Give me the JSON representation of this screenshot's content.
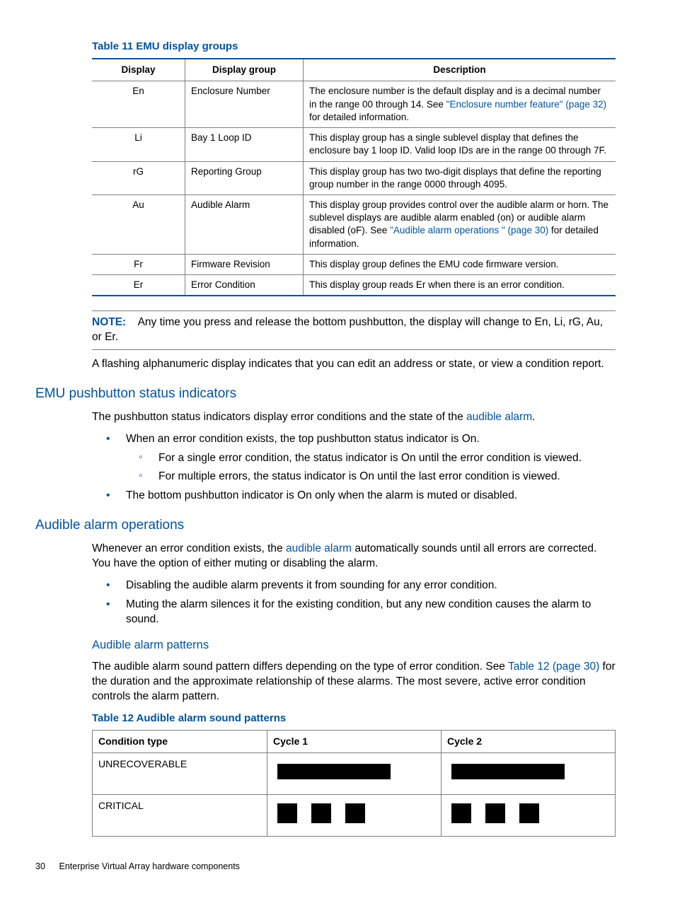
{
  "table11": {
    "caption": "Table 11 EMU display groups",
    "headers": [
      "Display",
      "Display group",
      "Description"
    ],
    "rows": [
      {
        "display": "En",
        "group": "Enclosure Number",
        "desc_pre": "The enclosure number is the default display and is a decimal number in the range 00 through 14. See ",
        "link": "\"Enclosure number feature\" (page 32)",
        "desc_post": " for detailed information."
      },
      {
        "display": "Li",
        "group": "Bay 1 Loop ID",
        "desc_pre": "This display group has a single sublevel display that defines the enclosure bay 1 loop ID. Valid loop IDs are in the range 00 through 7F.",
        "link": "",
        "desc_post": ""
      },
      {
        "display": "rG",
        "group": "Reporting Group",
        "desc_pre": "This display group has two two-digit displays that define the reporting group number in the range 0000 through 4095.",
        "link": "",
        "desc_post": ""
      },
      {
        "display": "Au",
        "group": "Audible Alarm",
        "desc_pre": "This display group provides control over the audible alarm or horn. The sublevel displays are audible alarm enabled (on) or audible alarm disabled (oF). See ",
        "link": "\"Audible alarm operations \" (page 30)",
        "desc_post": " for detailed information."
      },
      {
        "display": "Fr",
        "group": "Firmware Revision",
        "desc_pre": "This display group defines the EMU code firmware version.",
        "link": "",
        "desc_post": ""
      },
      {
        "display": "Er",
        "group": "Error Condition",
        "desc_pre": "This display group reads Er when there is an error condition.",
        "link": "",
        "desc_post": ""
      }
    ]
  },
  "note": {
    "label": "NOTE:",
    "text": " Any time you press and release the bottom pushbutton, the display will change to En, Li, rG, Au, or Er."
  },
  "para_after_note": "A flashing alphanumeric display indicates that you can edit an address or state, or view a condition report.",
  "sec1": {
    "title": "EMU pushbutton status indicators",
    "intro_pre": "The pushbutton status indicators display error conditions and the state of the ",
    "intro_link": "audible alarm",
    "intro_post": ".",
    "bullet1": "When an error condition exists, the top pushbutton status indicator is On.",
    "sub1": "For a single error condition, the status indicator is On until the error condition is viewed.",
    "sub2": "For multiple errors, the status indicator is On until the last error condition is viewed.",
    "bullet2": "The bottom pushbutton indicator is On only when the alarm is muted or disabled."
  },
  "sec2": {
    "title": "Audible alarm operations",
    "intro_pre": "Whenever an error condition exists, the ",
    "intro_link": "audible alarm",
    "intro_post": " automatically sounds until all errors are corrected. You have the option of either muting or disabling the alarm.",
    "bullet1": "Disabling the audible alarm prevents it from sounding for any error condition.",
    "bullet2": "Muting the alarm silences it for the existing condition, but any new condition causes the alarm to sound."
  },
  "sec3": {
    "title": "Audible alarm patterns",
    "para_pre": "The audible alarm sound pattern differs depending on the type of error condition. See ",
    "para_link": "Table 12 (page 30)",
    "para_post": " for the duration and the approximate relationship of these alarms. The most severe, active error condition controls the alarm pattern."
  },
  "table12": {
    "caption": "Table 12 Audible alarm sound patterns",
    "headers": [
      "Condition type",
      "Cycle 1",
      "Cycle 2"
    ],
    "rows": [
      {
        "condition": "UNRECOVERABLE",
        "pattern": "solid"
      },
      {
        "condition": "CRITICAL",
        "pattern": "seg3"
      }
    ]
  },
  "chart_data": [
    {
      "type": "bar",
      "title": "Audible alarm sound patterns",
      "categories": [
        "UNRECOVERABLE",
        "CRITICAL"
      ],
      "series": [
        {
          "name": "Cycle 1",
          "values": [
            "continuous",
            "3 pulses"
          ]
        },
        {
          "name": "Cycle 2",
          "values": [
            "continuous",
            "3 pulses"
          ]
        }
      ]
    }
  ],
  "footer": {
    "page": "30",
    "title": "Enterprise Virtual Array hardware components"
  }
}
